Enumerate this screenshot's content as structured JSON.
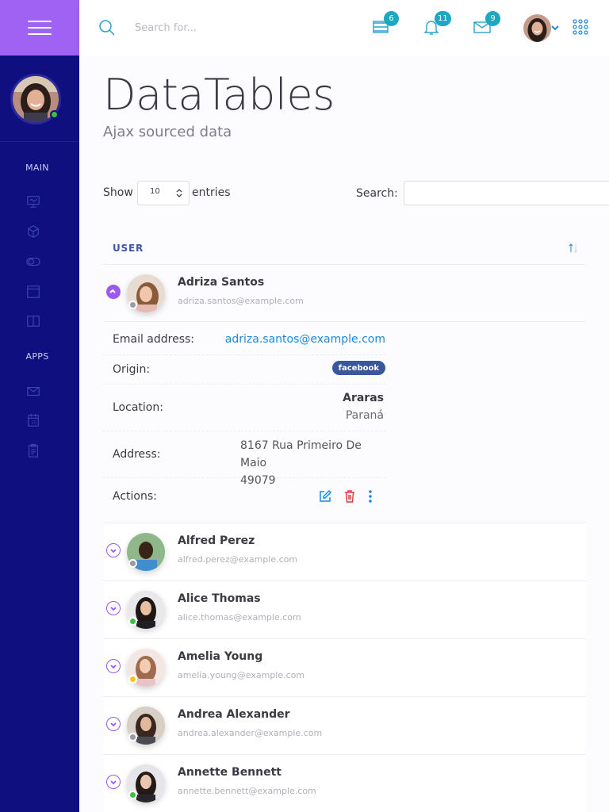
{
  "topbar": {
    "search_placeholder": "Search for...",
    "badges": {
      "tasks": "6",
      "notifications": "11",
      "messages": "9"
    }
  },
  "sidebar": {
    "headings": {
      "main": "MAIN",
      "apps": "APPS"
    },
    "main_icons": [
      "presentation-icon",
      "box-icon",
      "toggle-icon",
      "window-icon",
      "book-icon"
    ],
    "apps_icons": [
      "mail-icon",
      "calendar-icon",
      "clipboard-icon"
    ]
  },
  "page": {
    "title": "DataTables",
    "subtitle": "Ajax sourced data"
  },
  "table_controls": {
    "show": "Show",
    "length_value": "10",
    "entries": "entries",
    "search": "Search:"
  },
  "table": {
    "header": "USER",
    "rows": [
      {
        "name": "Adriza Santos",
        "email": "adriza.santos@example.com",
        "status": "offline",
        "expanded": true
      },
      {
        "name": "Alfred Perez",
        "email": "alfred.perez@example.com",
        "status": "offline",
        "expanded": false
      },
      {
        "name": "Alice Thomas",
        "email": "alice.thomas@example.com",
        "status": "online",
        "expanded": false
      },
      {
        "name": "Amelia Young",
        "email": "amelia.young@example.com",
        "status": "away",
        "expanded": false
      },
      {
        "name": "Andrea Alexander",
        "email": "andrea.alexander@example.com",
        "status": "offline",
        "expanded": false
      },
      {
        "name": "Annette Bennett",
        "email": "annette.bennett@example.com",
        "status": "online",
        "expanded": false
      }
    ],
    "details": {
      "email_label": "Email address:",
      "email_value": "adriza.santos@example.com",
      "origin_label": "Origin:",
      "origin_value": "facebook",
      "location_label": "Location:",
      "location_city": "Araras",
      "location_state": "Paraná",
      "address_label": "Address:",
      "address_line1": "8167 Rua Primeiro De Maio",
      "address_line2": "49079",
      "actions_label": "Actions:"
    }
  },
  "colors": {
    "sidebar": "#100f7f",
    "menu_block": "#a062f3",
    "accent_blue": "#1e88d8",
    "badge": "#1ca7c2",
    "online": "#34c242",
    "away": "#f6c518",
    "offline": "#9a9aa6",
    "delete": "#e0383e",
    "facebook": "#3a579d"
  }
}
